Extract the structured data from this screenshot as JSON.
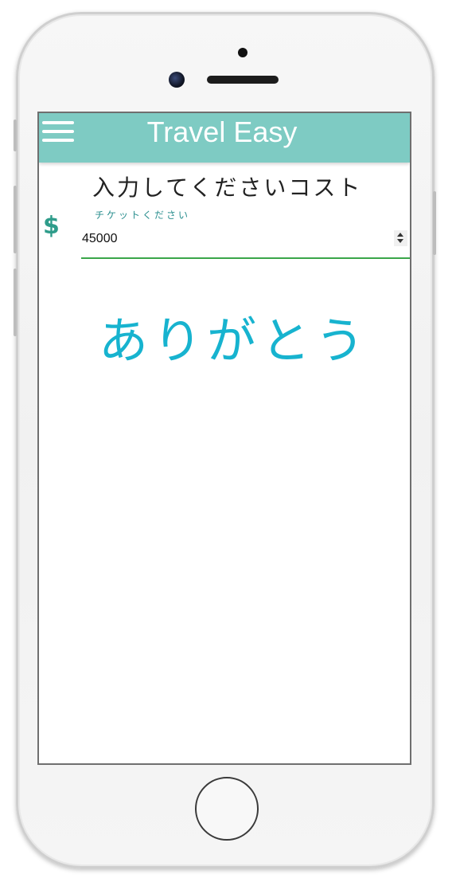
{
  "app": {
    "title": "Travel Easy"
  },
  "form": {
    "heading": "入力してくださいコスト",
    "field_label": "チケットください",
    "currency_symbol": "$",
    "cost_value": "45000"
  },
  "message": {
    "thanks": "ありがとう"
  },
  "icons": {
    "menu": "hamburger-menu-icon",
    "currency": "dollar-icon",
    "stepper": "number-stepper-icon"
  },
  "colors": {
    "appbar": "#7ecbc3",
    "accent_teal": "#2e9c8a",
    "thanks_text": "#17b3cf",
    "input_underline": "#3aa64a"
  }
}
